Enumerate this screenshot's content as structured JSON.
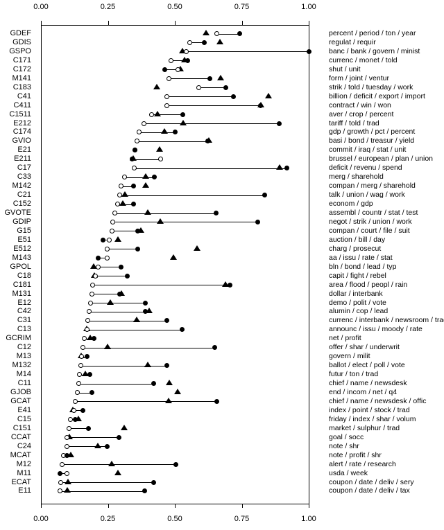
{
  "chart_data": {
    "type": "scatter",
    "title": "",
    "xlabel": "",
    "ylabel": "",
    "xlim": [
      0.0,
      1.0
    ],
    "grid": false,
    "legend_position": "none",
    "axis_top": true,
    "axis_bottom": true,
    "tick_labels": [
      "0.00",
      "0.25",
      "0.50",
      "0.75",
      "1.00"
    ],
    "tick_values": [
      0.0,
      0.25,
      0.5,
      0.75,
      1.0
    ],
    "series": [
      {
        "name": "open-circle",
        "marker": "open circle"
      },
      {
        "name": "filled-circle",
        "marker": "filled circle"
      },
      {
        "name": "triangle",
        "marker": "filled triangle"
      }
    ],
    "categories": [
      "GDEF",
      "GDIS",
      "GSPO",
      "C171",
      "C172",
      "M141",
      "C183",
      "C41",
      "C411",
      "C1511",
      "E212",
      "C174",
      "GVIO",
      "E21",
      "E211",
      "C17",
      "C33",
      "M142",
      "C21",
      "C152",
      "GVOTE",
      "GDIP",
      "G15",
      "E51",
      "E512",
      "M143",
      "GPOL",
      "C18",
      "C181",
      "M131",
      "E12",
      "C42",
      "C31",
      "C13",
      "GCRIM",
      "C12",
      "M13",
      "M132",
      "M14",
      "C11",
      "GJOB",
      "GCAT",
      "E41",
      "C15",
      "C151",
      "CCAT",
      "C24",
      "MCAT",
      "M12",
      "M11",
      "ECAT",
      "E11"
    ],
    "descriptions": [
      "percent / period / ton / year",
      "regulat / requir",
      "banc / bank / govern / minist",
      "currenc / monet / told",
      "shut / unit",
      "form / joint / ventur",
      "strik / told / tuesday / work",
      "billion / deficit / export / import",
      "contract / win / won",
      "aver / crop / percent",
      "tariff / told / trad",
      "gdp / growth / pct / percent",
      "basi / bond / treasur / yield",
      "commit / iraq / stat / unit",
      "brussel / european / plan / union",
      "deficit / revenu / spend",
      "merg / sharehold",
      "compan / merg / sharehold",
      "talk / union / wag / work",
      "econom / gdp",
      "assembl / countr / stat / test",
      "negot / strik / union / work",
      "compan / court / file / suit",
      "auction / bill / day",
      "charg / prosecut",
      "aa / issu / rate / stat",
      "bln / bond / lead / typ",
      "capit / fight / rebel",
      "area / flood / peopl / rain",
      "dollar / interbank",
      "demo / polit / vote",
      "alumin / cop / lead",
      "currenc / interbank / newsroom / trad",
      "announc / issu / moody / rate",
      "net / profit",
      "offer / shar / underwrit",
      "govern / milit",
      "ballot / elect / poll / vote",
      "futur / ton / trad",
      "chief / name / newsdesk",
      "end / incom / net / q4",
      "chief / name / newsdesk / offic",
      "index / point / stock / trad",
      "friday / index / shar / volum",
      "market / sulphur / trad",
      "goal / socc",
      "note / shr",
      "note / profit / shr",
      "alert / rate / research",
      "usda / week",
      "coupon / date / deliv / sery",
      "coupon / date / deliv / tax"
    ],
    "rows": [
      {
        "cat": "GDEF",
        "open": 0.657,
        "filled": 0.742,
        "tri": 0.616
      },
      {
        "cat": "GDIS",
        "open": 0.556,
        "filled": 0.61,
        "tri": 0.668
      },
      {
        "cat": "GSPO",
        "open": 0.544,
        "filled": 1.0,
        "tri": 0.528
      },
      {
        "cat": "C171",
        "open": 0.487,
        "filled": 0.548,
        "tri": 0.536
      },
      {
        "cat": "C172",
        "open": 0.512,
        "filled": 0.462,
        "tri": 0.52
      },
      {
        "cat": "M141",
        "open": 0.478,
        "filled": 0.63,
        "tri": 0.672
      },
      {
        "cat": "C183",
        "open": 0.59,
        "filled": 0.69,
        "tri": 0.432
      },
      {
        "cat": "C41",
        "open": 0.47,
        "filled": 0.718,
        "tri": 0.85
      },
      {
        "cat": "C411",
        "open": 0.47,
        "filled": 0.82,
        "tri": 0.822
      },
      {
        "cat": "C1511",
        "open": 0.412,
        "filled": 0.53,
        "tri": 0.434
      },
      {
        "cat": "E212",
        "open": 0.386,
        "filled": 0.89,
        "tri": 0.532
      },
      {
        "cat": "C174",
        "open": 0.367,
        "filled": 0.5,
        "tri": 0.462
      },
      {
        "cat": "GVIO",
        "open": 0.359,
        "filled": 0.622,
        "tri": 0.628
      },
      {
        "cat": "E21",
        "open": 0.352,
        "filled": 0.352,
        "tri": 0.443
      },
      {
        "cat": "E211",
        "open": 0.448,
        "filled": 0.34,
        "tri": 0.344
      },
      {
        "cat": "C17",
        "open": 0.348,
        "filled": 0.918,
        "tri": 0.89
      },
      {
        "cat": "C33",
        "open": 0.313,
        "filled": 0.423,
        "tri": 0.392
      },
      {
        "cat": "M142",
        "open": 0.3,
        "filled": 0.345,
        "tri": 0.39
      },
      {
        "cat": "C21",
        "open": 0.293,
        "filled": 0.835,
        "tri": 0.313
      },
      {
        "cat": "C152",
        "open": 0.286,
        "filled": 0.347,
        "tri": 0.305
      },
      {
        "cat": "GVOTE",
        "open": 0.275,
        "filled": 0.654,
        "tri": 0.4
      },
      {
        "cat": "GDIP",
        "open": 0.268,
        "filled": 0.81,
        "tri": 0.445
      },
      {
        "cat": "G15",
        "open": 0.265,
        "filled": 0.362,
        "tri": 0.372
      },
      {
        "cat": "E51",
        "open": 0.255,
        "filled": 0.233,
        "tri": 0.287
      },
      {
        "cat": "E512",
        "open": 0.248,
        "filled": 0.362,
        "tri": 0.582
      },
      {
        "cat": "M143",
        "open": 0.247,
        "filled": 0.213,
        "tri": 0.494
      },
      {
        "cat": "GPOL",
        "open": 0.215,
        "filled": 0.3,
        "tri": 0.198
      },
      {
        "cat": "C18",
        "open": 0.203,
        "filled": 0.323,
        "tri": 0.2
      },
      {
        "cat": "C181",
        "open": 0.193,
        "filled": 0.706,
        "tri": 0.69
      },
      {
        "cat": "M131",
        "open": 0.19,
        "filled": 0.293,
        "tri": 0.3
      },
      {
        "cat": "E12",
        "open": 0.185,
        "filled": 0.39,
        "tri": 0.258
      },
      {
        "cat": "C42",
        "open": 0.18,
        "filled": 0.39,
        "tri": 0.405
      },
      {
        "cat": "C31",
        "open": 0.176,
        "filled": 0.47,
        "tri": 0.358
      },
      {
        "cat": "C13",
        "open": 0.172,
        "filled": 0.528,
        "tri": 0.172
      },
      {
        "cat": "GCRIM",
        "open": 0.163,
        "filled": 0.197,
        "tri": 0.185
      },
      {
        "cat": "C12",
        "open": 0.158,
        "filled": 0.65,
        "tri": 0.248
      },
      {
        "cat": "M13",
        "open": 0.152,
        "filled": 0.172,
        "tri": 0.15
      },
      {
        "cat": "M132",
        "open": 0.148,
        "filled": 0.47,
        "tri": 0.4
      },
      {
        "cat": "M14",
        "open": 0.143,
        "filled": 0.183,
        "tri": 0.167
      },
      {
        "cat": "C11",
        "open": 0.14,
        "filled": 0.422,
        "tri": 0.478
      },
      {
        "cat": "GJOB",
        "open": 0.135,
        "filled": 0.19,
        "tri": 0.51
      },
      {
        "cat": "GCAT",
        "open": 0.128,
        "filled": 0.657,
        "tri": 0.477
      },
      {
        "cat": "E41",
        "open": 0.122,
        "filled": 0.158,
        "tri": 0.12
      },
      {
        "cat": "C15",
        "open": 0.11,
        "filled": 0.128,
        "tri": 0.14
      },
      {
        "cat": "C151",
        "open": 0.105,
        "filled": 0.178,
        "tri": 0.31
      },
      {
        "cat": "CCAT",
        "open": 0.098,
        "filled": 0.292,
        "tri": 0.105
      },
      {
        "cat": "C24",
        "open": 0.097,
        "filled": 0.248,
        "tri": 0.213
      },
      {
        "cat": "MCAT",
        "open": 0.083,
        "filled": 0.098,
        "tri": 0.112
      },
      {
        "cat": "M12",
        "open": 0.08,
        "filled": 0.505,
        "tri": 0.263
      },
      {
        "cat": "M11",
        "open": 0.098,
        "filled": 0.072,
        "tri": 0.288
      },
      {
        "cat": "ECAT",
        "open": 0.075,
        "filled": 0.42,
        "tri": 0.1
      },
      {
        "cat": "E11",
        "open": 0.072,
        "filled": 0.388,
        "tri": 0.098
      }
    ]
  }
}
